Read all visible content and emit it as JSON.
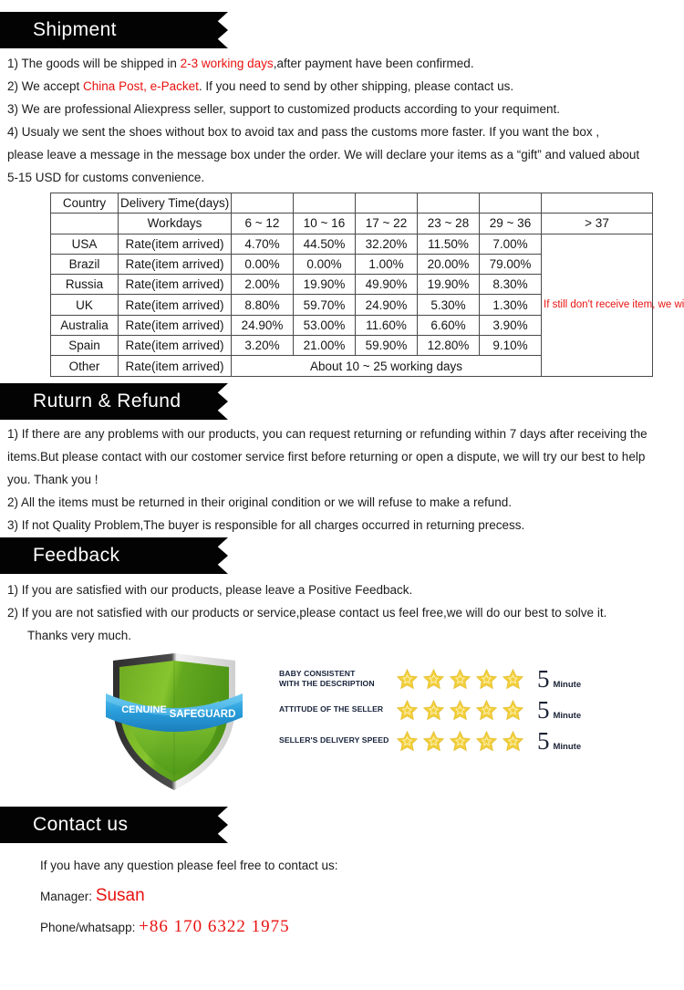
{
  "sections": {
    "shipment": {
      "title": "Shipment",
      "lines": [
        {
          "pre": "1) The goods will be shipped in ",
          "red": "2-3 working days",
          "post": ",after payment have been confirmed."
        },
        {
          "pre": "2) We accept ",
          "red": "China Post, e-Packet",
          "post": ". If you need to send by other shipping, please contact us."
        },
        {
          "pre": "3) We are professional Aliexpress seller, support to customized products according to your requiment.",
          "red": "",
          "post": ""
        },
        {
          "pre": "4) Usualy we sent the shoes without box to avoid tax and pass the customs more faster. If you want the box ,",
          "red": "",
          "post": ""
        },
        {
          "pre": "please leave a message in the message box under the order. We will declare your items as a “gift” and valued about",
          "red": "",
          "post": ""
        },
        {
          "pre": "5-15 USD for customs convenience.",
          "red": "",
          "post": ""
        }
      ]
    },
    "return_refund": {
      "title": "Ruturn & Refund",
      "lines": [
        "1) If there are any problems with our products, you can request returning or refunding within 7 days after receiving the",
        "items.But please contact with our costomer service first before returning or open a dispute, we will try our best to help",
        "you. Thank you !",
        "2) All the items must be returned in their original condition or we will refuse to make a refund.",
        "3) If not Quality Problem,The buyer is responsible for all charges occurred in returning precess."
      ]
    },
    "feedback": {
      "title": "Feedback",
      "lines": [
        "1) If you are satisfied with our products, please leave a Positive Feedback.",
        "2) If you are not satisfied with our products or service,please contact us feel free,we will do our best to solve it."
      ],
      "thanks": "Thanks very much."
    },
    "contact": {
      "title": "Contact us",
      "intro": "If you have any question please feel free to contact us:",
      "manager_label": "Manager:",
      "manager_name": "Susan",
      "phone_label": "Phone/whatsapp:",
      "phone_number": "+86  170  6322  1975"
    }
  },
  "delivery_table": {
    "header_row1": [
      "Country",
      "Delivery Time(days)",
      "",
      "",
      "",
      "",
      "",
      ""
    ],
    "header_row2": [
      "",
      "Workdays",
      "6 ~ 12",
      "10 ~ 16",
      "17 ~ 22",
      "23 ~ 28",
      "29 ~ 36",
      "> 37"
    ],
    "rows": [
      {
        "country": "USA",
        "rate_label": "Rate(item arrived)",
        "values": [
          "4.70%",
          "44.50%",
          "32.20%",
          "11.50%",
          "7.00%"
        ]
      },
      {
        "country": "Brazil",
        "rate_label": "Rate(item arrived)",
        "values": [
          "0.00%",
          "0.00%",
          "1.00%",
          "20.00%",
          "79.00%"
        ]
      },
      {
        "country": "Russia",
        "rate_label": "Rate(item arrived)",
        "values": [
          "2.00%",
          "19.90%",
          "49.90%",
          "19.90%",
          "8.30%"
        ]
      },
      {
        "country": "UK",
        "rate_label": "Rate(item arrived)",
        "values": [
          "8.80%",
          "59.70%",
          "24.90%",
          "5.30%",
          "1.30%"
        ]
      },
      {
        "country": "Australia",
        "rate_label": "Rate(item arrived)",
        "values": [
          "24.90%",
          "53.00%",
          "11.60%",
          "6.60%",
          "3.90%"
        ]
      },
      {
        "country": "Spain",
        "rate_label": "Rate(item arrived)",
        "values": [
          "3.20%",
          "21.00%",
          "59.90%",
          "12.80%",
          "9.10%"
        ]
      }
    ],
    "other_row": {
      "country": "Other",
      "rate_label": "Rate(item arrived)",
      "span_text": "About 10 ~ 25 working days"
    },
    "note": "If still don't receive item, we will help to check. if confirm lost we will resend item.",
    "note_color": "#e8120f"
  },
  "trust": {
    "shield": {
      "left_word": "CENUINE",
      "right_word": "SAFEGUARD",
      "green": "#72b52a",
      "ribbon_blue": "#2ea2dd"
    },
    "ratings": [
      {
        "label": [
          "BABY  CONSISTENT",
          "WITH THE DESCRIPTION"
        ],
        "stars": 5,
        "score": "5",
        "unit": "Minute"
      },
      {
        "label": [
          "ATTITUDE OF THE SELLER"
        ],
        "stars": 5,
        "score": "5",
        "unit": "Minute"
      },
      {
        "label": [
          "SELLER'S DELIVERY SPEED"
        ],
        "stars": 5,
        "score": "5",
        "unit": "Minute"
      }
    ],
    "star_color": "#f2cf3c"
  },
  "colors": {
    "banner_bg": "#030303",
    "accent_red": "#e8120f",
    "text": "#1b1b1b"
  }
}
